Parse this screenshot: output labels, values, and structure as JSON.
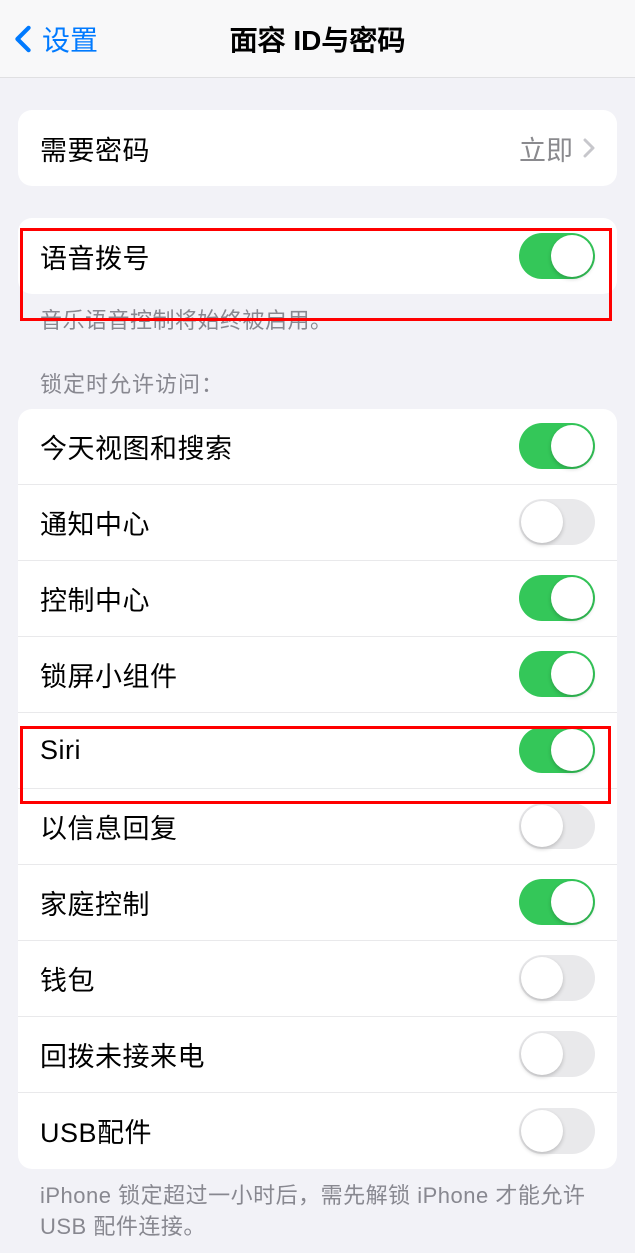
{
  "nav": {
    "back_label": "设置",
    "title": "面容 ID与密码"
  },
  "require_passcode": {
    "label": "需要密码",
    "value": "立即"
  },
  "voice_dial": {
    "label": "语音拨号",
    "on": true,
    "footer": "音乐语音控制将始终被启用。"
  },
  "allow_access_header": "锁定时允许访问：",
  "allow_access": {
    "items": [
      {
        "label": "今天视图和搜索",
        "on": true
      },
      {
        "label": "通知中心",
        "on": false
      },
      {
        "label": "控制中心",
        "on": true
      },
      {
        "label": "锁屏小组件",
        "on": true
      },
      {
        "label": "Siri",
        "on": true
      },
      {
        "label": "以信息回复",
        "on": false
      },
      {
        "label": "家庭控制",
        "on": true
      },
      {
        "label": "钱包",
        "on": false
      },
      {
        "label": "回拨未接来电",
        "on": false
      },
      {
        "label": "USB配件",
        "on": false
      }
    ],
    "footer": "iPhone 锁定超过一小时后，需先解锁 iPhone 才能允许 USB 配件连接。"
  }
}
